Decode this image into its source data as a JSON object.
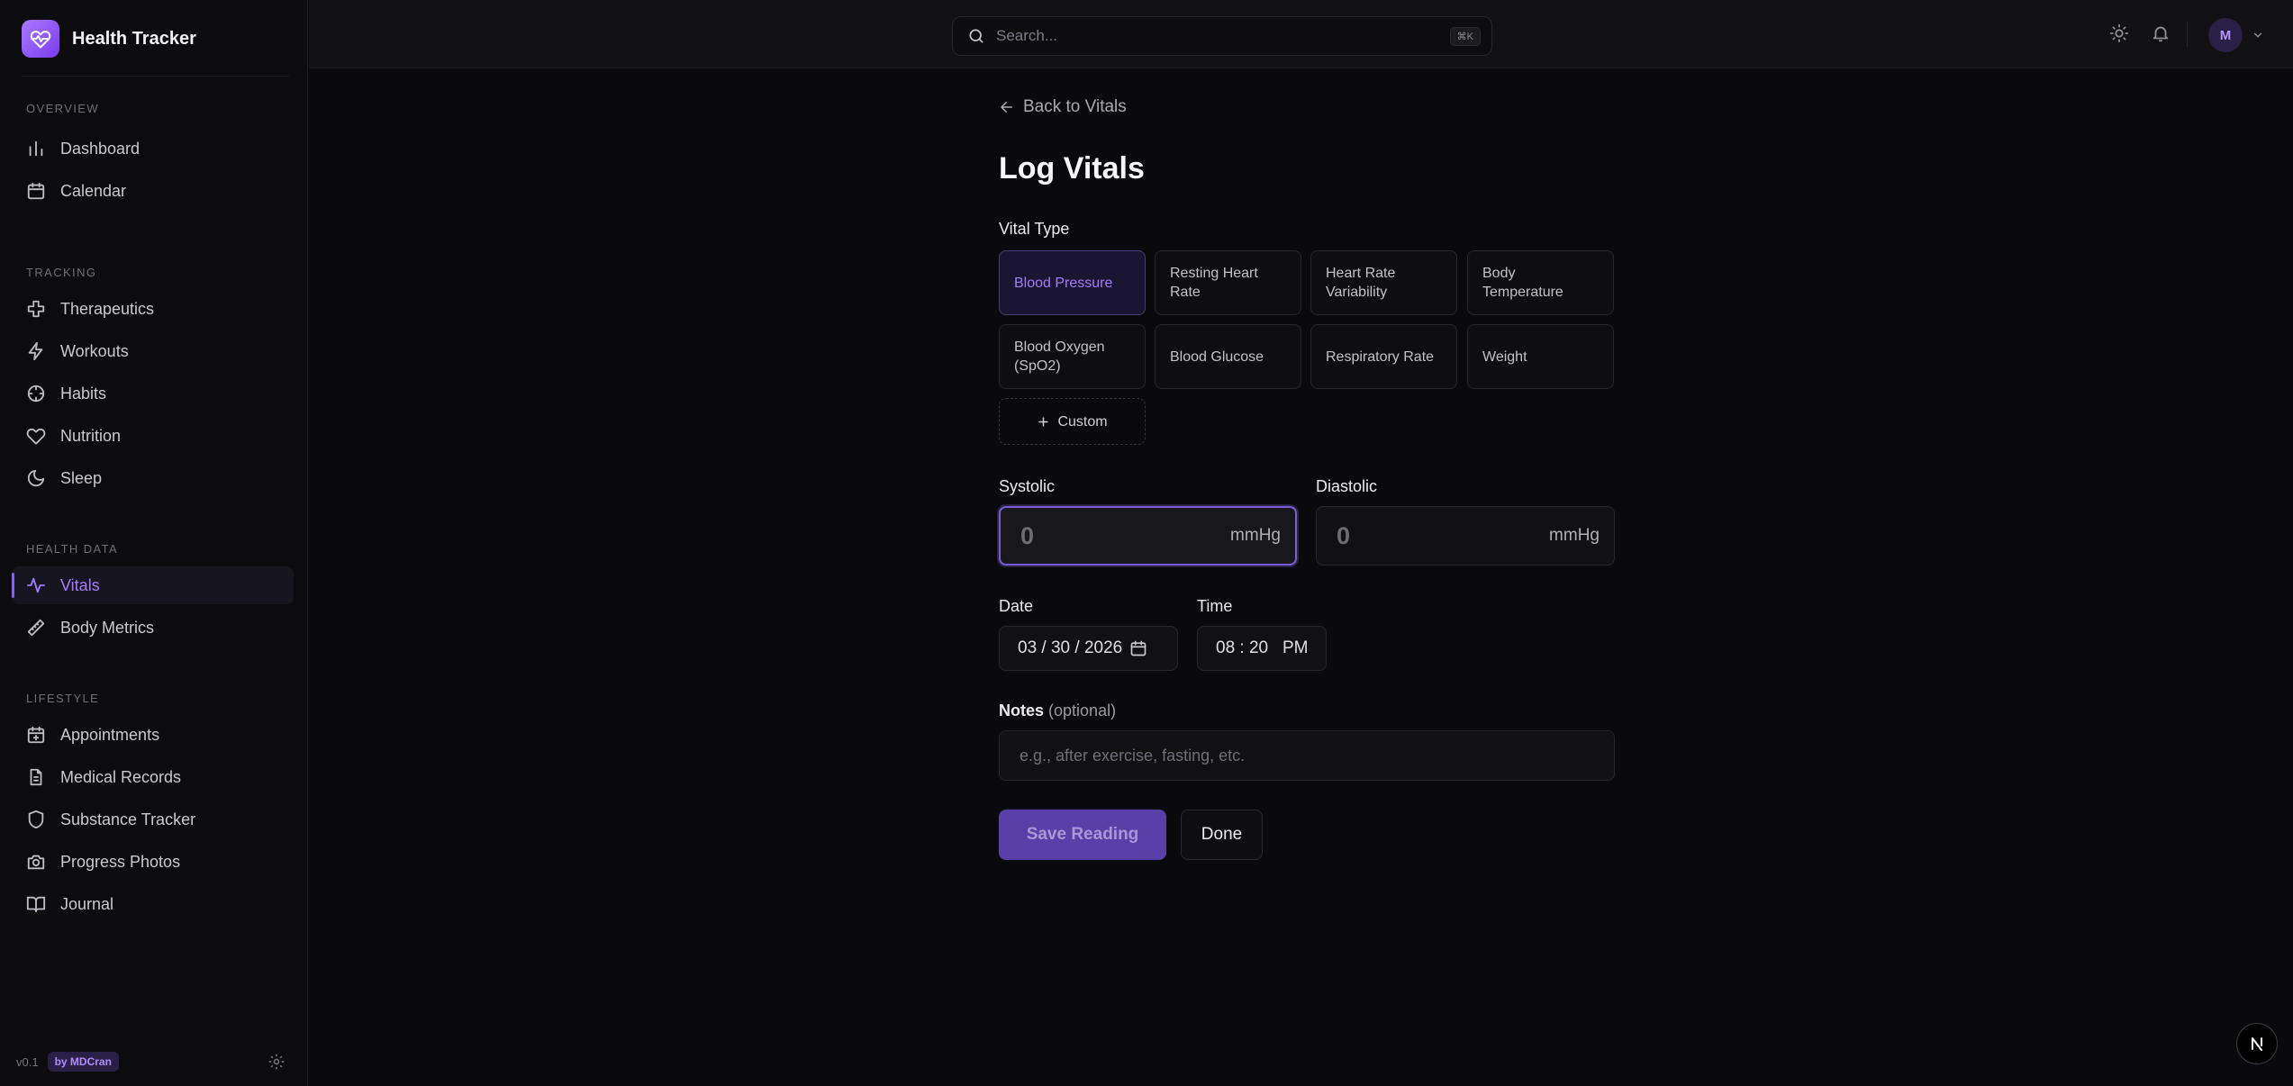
{
  "app": {
    "name": "Health Tracker"
  },
  "sidebar": {
    "sections": [
      {
        "title": "OVERVIEW",
        "items": [
          {
            "label": "Dashboard",
            "icon": "bar-chart-icon"
          },
          {
            "label": "Calendar",
            "icon": "calendar-icon"
          }
        ]
      },
      {
        "title": "TRACKING",
        "items": [
          {
            "label": "Therapeutics",
            "icon": "cross-icon"
          },
          {
            "label": "Workouts",
            "icon": "bolt-icon"
          },
          {
            "label": "Habits",
            "icon": "target-icon"
          },
          {
            "label": "Nutrition",
            "icon": "heart-icon"
          },
          {
            "label": "Sleep",
            "icon": "moon-icon"
          }
        ]
      },
      {
        "title": "HEALTH DATA",
        "items": [
          {
            "label": "Vitals",
            "icon": "activity-icon",
            "active": true
          },
          {
            "label": "Body Metrics",
            "icon": "ruler-icon"
          }
        ]
      },
      {
        "title": "LIFESTYLE",
        "items": [
          {
            "label": "Appointments",
            "icon": "calendar-plus-icon"
          },
          {
            "label": "Medical Records",
            "icon": "file-icon"
          },
          {
            "label": "Substance Tracker",
            "icon": "shield-icon"
          },
          {
            "label": "Progress Photos",
            "icon": "camera-icon"
          },
          {
            "label": "Journal",
            "icon": "book-icon"
          }
        ]
      }
    ],
    "footer": {
      "version": "v0.1",
      "author": "by MDCran"
    }
  },
  "topbar": {
    "search_placeholder": "Search...",
    "search_shortcut": "⌘K",
    "avatar_initial": "M"
  },
  "form": {
    "back_label": "Back to Vitals",
    "title": "Log Vitals",
    "vital_type_label": "Vital Type",
    "vital_types": [
      {
        "label": "Blood Pressure",
        "selected": true
      },
      {
        "label": "Resting Heart Rate"
      },
      {
        "label": "Heart Rate Variability"
      },
      {
        "label": "Body Temperature"
      },
      {
        "label": "Blood Oxygen (SpO2)"
      },
      {
        "label": "Blood Glucose"
      },
      {
        "label": "Respiratory Rate"
      },
      {
        "label": "Weight"
      }
    ],
    "custom_label": "Custom",
    "systolic": {
      "label": "Systolic",
      "placeholder": "0",
      "unit": "mmHg"
    },
    "diastolic": {
      "label": "Diastolic",
      "placeholder": "0",
      "unit": "mmHg"
    },
    "date": {
      "label": "Date",
      "value": "03 / 30 / 2026"
    },
    "time": {
      "label": "Time",
      "value": "08 : 20   PM"
    },
    "notes": {
      "label": "Notes",
      "optional": "(optional)",
      "placeholder": "e.g., after exercise, fasting, etc."
    },
    "save_label": "Save Reading",
    "done_label": "Done"
  },
  "colors": {
    "accent": "#8b5cf6",
    "background": "#0a0a0c",
    "sidebar": "#0c0c0e"
  }
}
